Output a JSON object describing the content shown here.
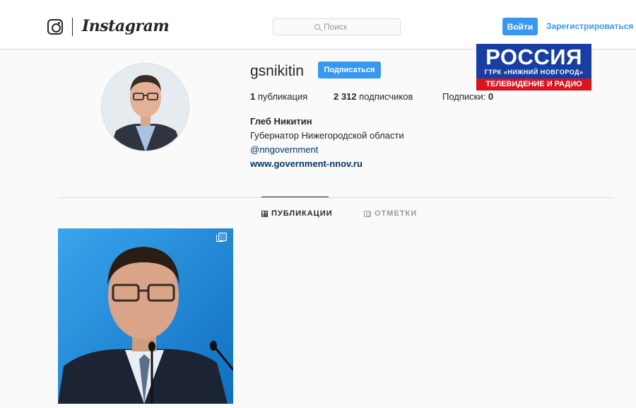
{
  "header": {
    "brand": "Instagram",
    "search_placeholder": "Поиск",
    "login_label": "Войти",
    "register_label": "Зарегистрироваться"
  },
  "profile": {
    "username": "gsnikitin",
    "follow_label": "Подписаться",
    "stats": {
      "posts_count": "1",
      "posts_label": "публикация",
      "followers_count": "2 312",
      "followers_label": "подписчиков",
      "following_label": "Подписки:",
      "following_count": "0"
    },
    "full_name": "Глеб Никитин",
    "bio": "Губернатор Нижегородской области",
    "mention": "@nngovernment",
    "website": "www.government-nnov.ru"
  },
  "tabs": [
    {
      "label": "ПУБЛИКАЦИИ",
      "icon": "grid-icon",
      "active": true
    },
    {
      "label": "ОТМЕТКИ",
      "icon": "tag-icon",
      "active": false
    }
  ],
  "tv_watermark": {
    "name": "РОССИЯ",
    "sub": "ГТРК «НИЖНИЙ НОВГОРОД»",
    "band": "ТЕЛЕВИДЕНИЕ И РАДИО"
  },
  "colors": {
    "accent": "#3897f0",
    "link": "#003569",
    "tv_blue": "#173ea0",
    "tv_red": "#d8141d"
  }
}
